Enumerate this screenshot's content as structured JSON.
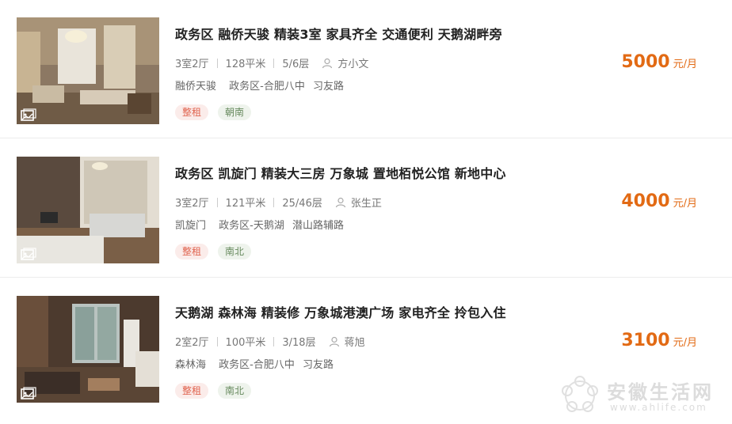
{
  "listings": [
    {
      "title": "政务区 融侨天骏 精装3室 家具齐全 交通便利 天鹅湖畔旁",
      "layout": "3室2厅",
      "area": "128平米",
      "floor": "5/6层",
      "agent": "方小文",
      "community": "融侨天骏",
      "district": "政务区-合肥八中",
      "road": "习友路",
      "rent_type": "整租",
      "orientation": "朝南",
      "price": "5000",
      "price_unit": "元/月",
      "icon": "photo-icon"
    },
    {
      "title": "政务区 凯旋门 精装大三房 万象城 置地栢悦公馆 新地中心",
      "layout": "3室2厅",
      "area": "121平米",
      "floor": "25/46层",
      "agent": "张生正",
      "community": "凯旋门",
      "district": "政务区-天鹅湖",
      "road": "潜山路辅路",
      "rent_type": "整租",
      "orientation": "南北",
      "price": "4000",
      "price_unit": "元/月",
      "icon": "photo-icon"
    },
    {
      "title": "天鹅湖 森林海 精装修 万象城港澳广场 家电齐全 拎包入住",
      "layout": "2室2厅",
      "area": "100平米",
      "floor": "3/18层",
      "agent": "蒋旭",
      "community": "森林海",
      "district": "政务区-合肥八中",
      "road": "习友路",
      "rent_type": "整租",
      "orientation": "南北",
      "price": "3100",
      "price_unit": "元/月",
      "icon": "photo-icon"
    }
  ],
  "watermark": {
    "text": "安徽生活网",
    "url": "www.ahlife.com"
  },
  "colors": {
    "price": "#e26a14",
    "tag_type_bg": "#fbecea",
    "tag_type_text": "#e0634f",
    "tag_dir_bg": "#eef3ec",
    "tag_dir_text": "#678a5e"
  }
}
